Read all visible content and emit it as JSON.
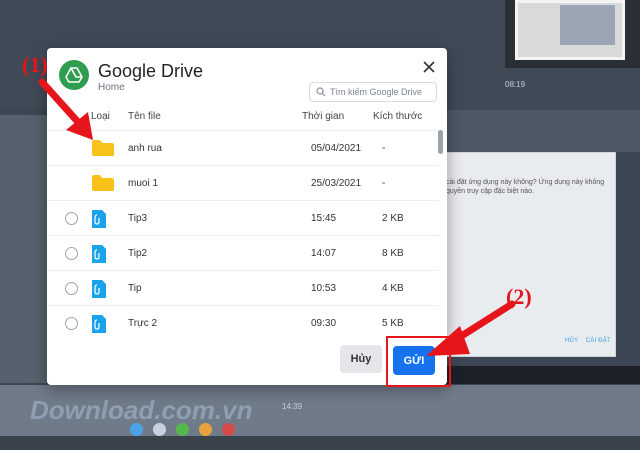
{
  "background": {
    "time_top": "08:19",
    "time_bottom": "14:39",
    "chat_text": "cài đặt ứng dụng này không? Ứng dụng này không  quyền truy cập đặc biệt nào.",
    "chat_btn_deny": "HỦY",
    "chat_btn_install": "CÀI ĐẶT",
    "watermark": "Download.com.vn"
  },
  "annotations": {
    "step1": "(1)",
    "step2": "(2)",
    "color": "#e6141b"
  },
  "dialog": {
    "title": "Google Drive",
    "subtitle": "Home",
    "search_placeholder": "Tìm kiếm Google Drive",
    "columns": {
      "type": "Loại",
      "name": "Tên file",
      "time": "Thời gian",
      "size": "Kích thước"
    },
    "rows": [
      {
        "kind": "folder",
        "name": "anh rua",
        "time": "05/04/2021",
        "size": "-"
      },
      {
        "kind": "folder",
        "name": "muoi 1",
        "time": "25/03/2021",
        "size": "-"
      },
      {
        "kind": "file",
        "name": "Tip3",
        "time": "15:45",
        "size": "2 KB"
      },
      {
        "kind": "file",
        "name": "Tip2",
        "time": "14:07",
        "size": "8 KB"
      },
      {
        "kind": "file",
        "name": "Tip",
        "time": "10:53",
        "size": "4 KB"
      },
      {
        "kind": "file",
        "name": "Trực 2",
        "time": "09:30",
        "size": "5 KB"
      }
    ],
    "cancel_label": "Hủy",
    "send_label": "GỬI",
    "accent_color": "#1672ee",
    "folder_color": "#f7c31a",
    "file_icon_color": "#1aa3e8"
  }
}
